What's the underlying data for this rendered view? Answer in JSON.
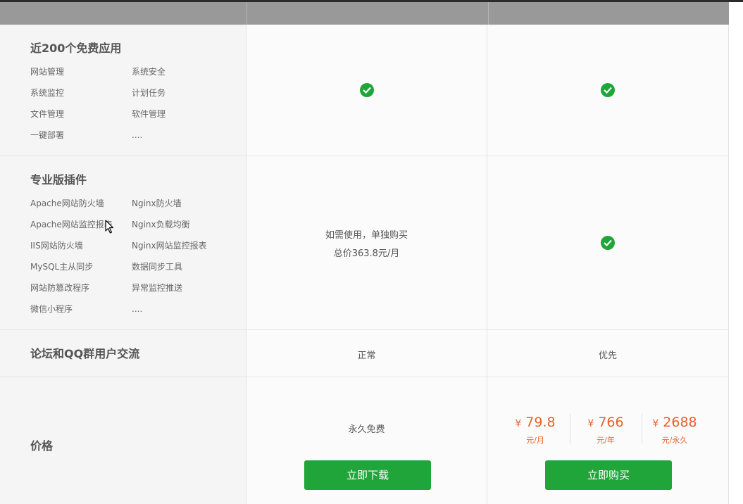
{
  "rows": {
    "apps": {
      "title": "近200个免费应用",
      "features": [
        "网站管理",
        "系统安全",
        "系统监控",
        "计划任务",
        "文件管理",
        "软件管理",
        "一键部署",
        "...."
      ]
    },
    "plugins": {
      "title": "专业版插件",
      "features": [
        "Apache网站防火墙",
        "Nginx防火墙",
        "Apache网站监控报表",
        "Nginx负载均衡",
        "IIS网站防火墙",
        "Nginx网站监控报表",
        "MySQL主从同步",
        "数据同步工具",
        "网站防篡改程序",
        "异常监控推送",
        "微信小程序",
        "...."
      ],
      "free_line1": "如需使用，单独购买",
      "free_line2": "总价363.8元/月"
    },
    "community": {
      "title": "论坛和QQ群用户交流",
      "free_value": "正常",
      "pro_value": "优先"
    },
    "price": {
      "title": "价格",
      "free_value": "永久免费",
      "download_label": "立即下载",
      "buy_label": "立即购买",
      "currency": "¥",
      "options": [
        {
          "amount": "79.8",
          "unit": "元/月"
        },
        {
          "amount": "766",
          "unit": "元/年"
        },
        {
          "amount": "2688",
          "unit": "元/永久"
        }
      ]
    }
  },
  "colors": {
    "accent_green": "#20a53a",
    "price_orange": "#e8612b",
    "header_gray": "#999999"
  },
  "icons": {
    "check": "check-circle-icon",
    "cursor": "mouse-pointer-icon"
  }
}
